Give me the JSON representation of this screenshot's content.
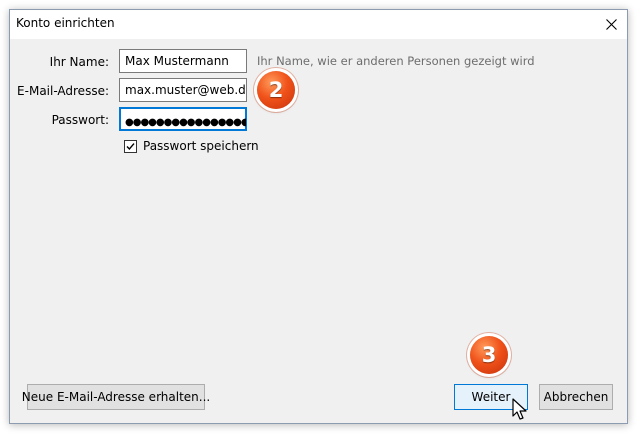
{
  "dialog": {
    "title": "Konto einrichten",
    "close_icon": "close-icon"
  },
  "form": {
    "name_label": "Ihr Name:",
    "name_value": "Max Mustermann",
    "name_hint": "Ihr Name, wie er anderen Personen gezeigt wird",
    "email_label": "E-Mail-Adresse:",
    "email_value": "max.muster@web.de",
    "password_label": "Passwort:",
    "password_value": "●●●●●●●●●●●●●●●●",
    "remember_label": "Passwort speichern",
    "remember_checked": true
  },
  "buttons": {
    "new_address": "Neue E-Mail-Adresse erhalten...",
    "next": "Weiter",
    "cancel": "Abbrechen"
  },
  "callouts": {
    "step2": "2",
    "step3": "3"
  },
  "colors": {
    "accent": "#0078d7",
    "callout": "#f0521a"
  }
}
